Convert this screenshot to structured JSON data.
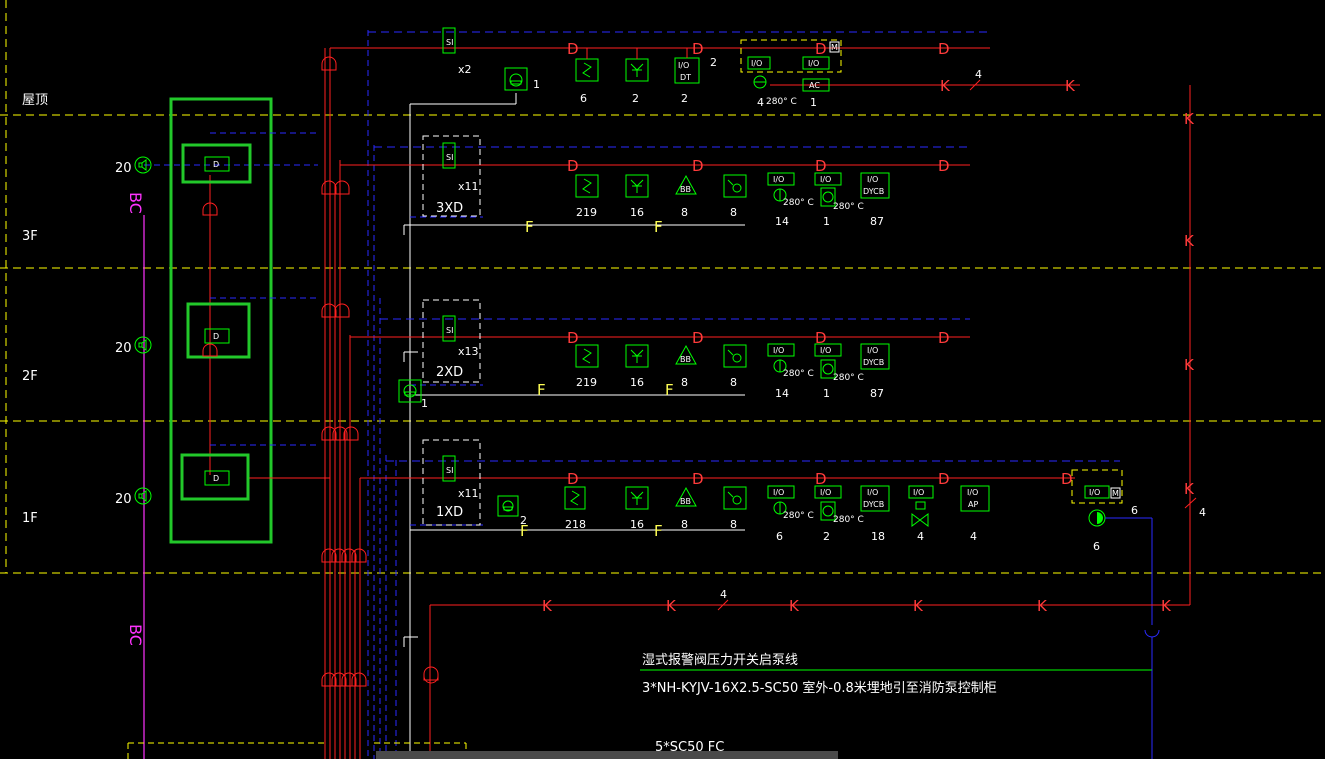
{
  "colors": {
    "background": "#000000",
    "floor_line": "#ffff00",
    "signal_bus": "#ff2020",
    "power_bus": "#2a2aff",
    "device": "#00ff00",
    "broadcast": "#ff33ff",
    "text": "#ffffff",
    "highlight": "#22c82a"
  },
  "floors": {
    "roof": "屋顶",
    "f3": "3F",
    "f2": "2F",
    "f1": "1F"
  },
  "broadcast": {
    "label_top": "BC",
    "label_bottom": "BC",
    "speaker_count_3f": "20",
    "speaker_count_2f": "20",
    "speaker_count_1f": "20",
    "speaker_icon": "speaker-icon"
  },
  "highlight_panel": {
    "module_3f": "D",
    "module_2f": "D",
    "module_1f": "D"
  },
  "roof": {
    "isolator": "SI",
    "isolator_qty": "x2",
    "phone_qty": "1",
    "smoke_qty": "6",
    "heat_qty": "2",
    "io_dt_line1": "I/O",
    "io_dt_line2": "DT",
    "io_dt_qty": "2",
    "io_dt_count": "2",
    "io_a": "I/O",
    "io_b": "I/O",
    "io_mark": "M",
    "ac_label": "AC",
    "valve_temp": "280° C",
    "valve_qty": "4",
    "ac_qty": "1",
    "k_qty": "4"
  },
  "f3": {
    "isolator": "SI",
    "isolator_qty": "x11",
    "panel": "3XD",
    "smoke_qty": "219",
    "heat_qty": "16",
    "bell_icon_text": "BB",
    "bell_qty": "8",
    "manual_qty": "8",
    "io1": "I/O",
    "io1_temp": "280° C",
    "io1_qty": "14",
    "io2": "I/O",
    "io2_temp": "280° C",
    "io2_qty": "1",
    "io3_line1": "I/O",
    "io3_line2": "DYCB",
    "io3_qty": "87"
  },
  "f2": {
    "isolator": "SI",
    "isolator_qty": "x13",
    "panel": "2XD",
    "phone_qty": "1",
    "smoke_qty": "219",
    "heat_qty": "16",
    "bell_icon_text": "BB",
    "bell_qty": "8",
    "manual_qty": "8",
    "io1": "I/O",
    "io1_temp": "280° C",
    "io1_qty": "14",
    "io2": "I/O",
    "io2_temp": "280° C",
    "io2_qty": "1",
    "io3_line1": "I/O",
    "io3_line2": "DYCB",
    "io3_qty": "87"
  },
  "f1": {
    "isolator": "SI",
    "isolator_qty": "x11",
    "panel": "1XD",
    "phone_qty": "2",
    "smoke_qty": "218",
    "heat_qty": "16",
    "bell_icon_text": "BB",
    "bell_qty": "8",
    "manual_qty": "8",
    "io1": "I/O",
    "io1_temp": "280° C",
    "io1_qty": "6",
    "io2": "I/O",
    "io2_temp": "280° C",
    "io2_qty": "2",
    "io3_line1": "I/O",
    "io3_line2": "DYCB",
    "io3_qty": "18",
    "io4": "I/O",
    "io4_qty": "4",
    "io5_line1": "I/O",
    "io5_line2": "AP",
    "io5_qty": "4",
    "pump_io": "I/O",
    "pump_mark": "M",
    "pump_qty_a": "6",
    "pump_qty_b": "6",
    "k_qty": "4"
  },
  "bus_symbols": {
    "d": "D",
    "f": "F",
    "k": "K"
  },
  "bottom_line": {
    "k_qty": "4",
    "note1": "湿式报警阀压力开关启泵线",
    "note2": "3*NH-KYJV-16X2.5-SC50 室外-0.8米埋地引至消防泵控制柜",
    "note3": "5*SC50 FC"
  }
}
